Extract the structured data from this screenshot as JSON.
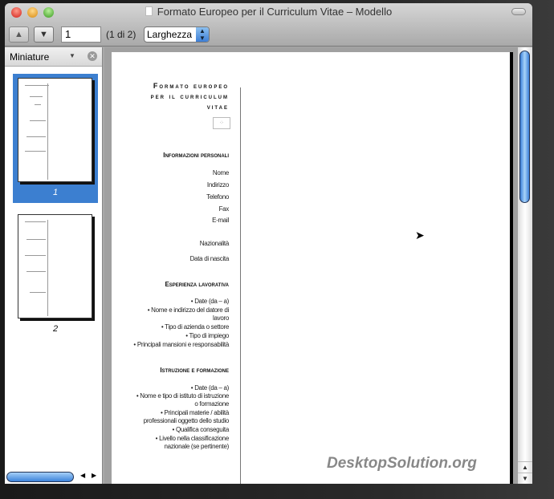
{
  "window": {
    "title": "Formato Europeo per il Curriculum Vitae – Modello"
  },
  "toolbar": {
    "prev_icon": "▲",
    "next_icon": "▼",
    "page_value": "1",
    "page_count": "(1 di 2)",
    "zoom_mode": "Larghezza"
  },
  "sidebar": {
    "title": "Miniature",
    "thumbnails": [
      {
        "label": "1"
      },
      {
        "label": "2"
      }
    ]
  },
  "document": {
    "title": [
      "Formato europeo",
      "per il curriculum",
      "vitae"
    ],
    "sections": [
      {
        "heading": "Informazioni personali",
        "items": [
          "Nome",
          "Indirizzo",
          "Telefono",
          "Fax",
          "E-mail",
          "Nazionalità",
          "Data di nascita"
        ]
      },
      {
        "heading": "Esperienza lavorativa",
        "items": [
          "• Date (da – a)",
          "• Nome e indirizzo del datore di lavoro",
          "• Tipo di azienda o settore",
          "• Tipo di impiego",
          "• Principali mansioni e responsabilità"
        ]
      },
      {
        "heading": "Istruzione e formazione",
        "items": [
          "• Date (da – a)",
          "• Nome e tipo di istituto di istruzione o formazione",
          "• Principali materie / abilità professionali oggetto dello studio",
          "• Qualifica conseguita",
          "• Livello nella classificazione nazionale (se pertinente)"
        ]
      }
    ]
  },
  "watermark": "DesktopSolution.org"
}
